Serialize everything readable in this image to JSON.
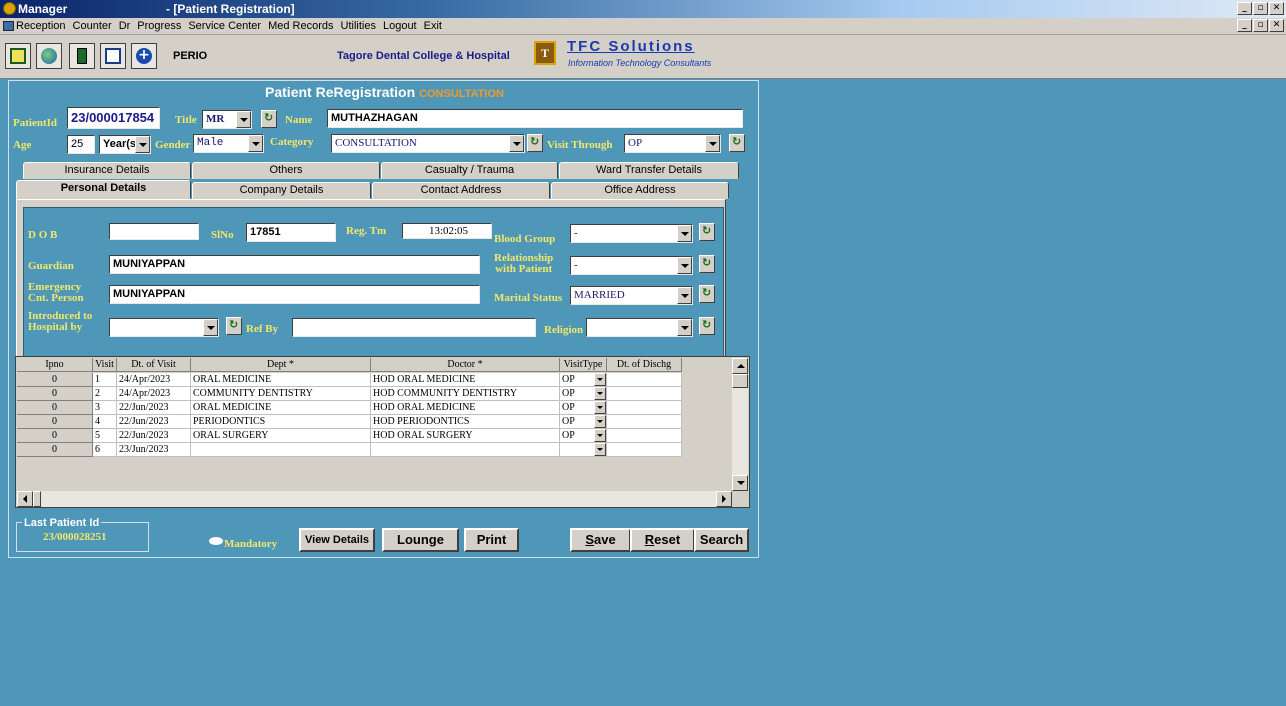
{
  "window": {
    "app_title": "Manager",
    "doc_title": "- [Patient Registration]"
  },
  "menu": [
    "Reception",
    "Counter",
    "Dr",
    "Progress",
    "Service Center",
    "Med Records",
    "Utilities",
    "Logout",
    "Exit"
  ],
  "toolbar": {
    "icons": [
      "register-icon",
      "globe-icon",
      "calculator-icon",
      "transfer-icon",
      "medical-cross-icon"
    ],
    "dept": "PERIO",
    "college": "Tagore Dental College & Hospital",
    "logo_letter": "T",
    "brand": "TFC Solutions",
    "brand_sub": "Information Technology Consultants"
  },
  "header": {
    "title": "Patient ReRegistration",
    "subtitle": "CONSULTATION"
  },
  "top_form": {
    "patient_id_label": "PatientId",
    "patient_id": "23/000017854",
    "title_label": "Title",
    "title": "MR",
    "name_label": "Name",
    "name": "MUTHAZHAGAN",
    "age_label": "Age",
    "age": "25",
    "age_unit": "Year(s",
    "gender_label": "Gender",
    "gender": "Male",
    "category_label": "Category",
    "category": "CONSULTATION",
    "visit_through_label": "Visit Through",
    "visit_through": "OP"
  },
  "tabs_row1": [
    "Insurance Details",
    "Others",
    "Casualty / Trauma",
    "Ward Transfer Details"
  ],
  "tabs_row2": [
    "Personal Details",
    "Company Details",
    "Contact Address",
    "Office Address"
  ],
  "personal": {
    "dob_label": "D O B",
    "dob": "",
    "slno_label": "SlNo",
    "slno": "17851",
    "regtm_label": "Reg. Tm",
    "regtm": "13:02:05",
    "blood_group_label": "Blood Group",
    "blood_group": "-",
    "guardian_label": "Guardian",
    "guardian": "MUNIYAPPAN",
    "relationship_label_1": "Relationship",
    "relationship_label_2": "with Patient",
    "relationship": "-",
    "emergency_label_1": "Emergency",
    "emergency_label_2": "Cnt. Person",
    "emergency": "MUNIYAPPAN",
    "marital_label": "Marital Status",
    "marital": "MARRIED",
    "introduced_label_1": "Introduced to",
    "introduced_label_2": "Hospital by",
    "introduced": "",
    "refby_label": "Ref By",
    "refby": "",
    "religion_label": "Religion",
    "religion": ""
  },
  "grid": {
    "headers": [
      "Ipno",
      "Visit",
      "Dt. of Visit",
      "Dept *",
      "Doctor *",
      "VisitType",
      "Dt. of Dischg"
    ],
    "rows": [
      [
        "0",
        "1",
        "24/Apr/2023",
        "ORAL MEDICINE",
        "HOD ORAL MEDICINE",
        "OP",
        ""
      ],
      [
        "0",
        "2",
        "24/Apr/2023",
        "COMMUNITY DENTISTRY",
        "HOD COMMUNITY DENTISTRY",
        "OP",
        ""
      ],
      [
        "0",
        "3",
        "22/Jun/2023",
        "ORAL MEDICINE",
        "HOD ORAL MEDICINE",
        "OP",
        ""
      ],
      [
        "0",
        "4",
        "22/Jun/2023",
        "PERIODONTICS",
        "HOD PERIODONTICS",
        "OP",
        ""
      ],
      [
        "0",
        "5",
        "22/Jun/2023",
        "ORAL SURGERY",
        "HOD ORAL SURGERY",
        "OP",
        ""
      ],
      [
        "0",
        "6",
        "23/Jun/2023",
        "",
        "",
        "",
        ""
      ]
    ]
  },
  "footer": {
    "last_patient_label": "Last Patient Id",
    "last_patient_id": "23/000028251",
    "mandatory_label": "Mandatory",
    "view_details": "View Details",
    "lounge": "Lounge",
    "print": "Print",
    "save_u": "S",
    "save_rest": "ave",
    "reset_u": "R",
    "reset_rest": "eset",
    "search": "Search"
  }
}
